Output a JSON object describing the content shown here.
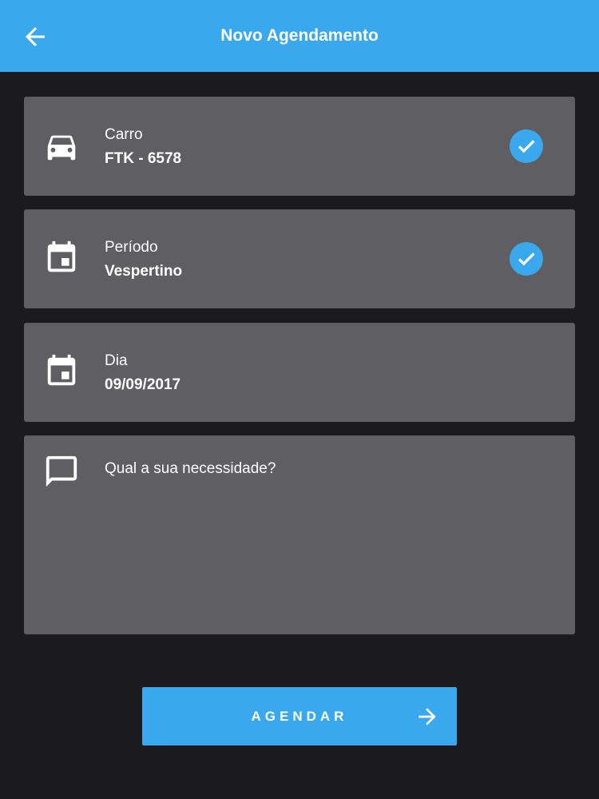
{
  "header": {
    "title": "Novo Agendamento",
    "back_icon": "arrow-left-icon",
    "background_color": "#3aa8ec"
  },
  "fields": [
    {
      "label": "Carro",
      "value": "FTK - 6578",
      "icon": "car-icon",
      "checked": true
    },
    {
      "label": "Período",
      "value": "Vespertino",
      "icon": "calendar-icon",
      "checked": true
    },
    {
      "label": "Dia",
      "value": "09/09/2017",
      "icon": "calendar-icon",
      "checked": false
    }
  ],
  "notes": {
    "placeholder": "Qual a sua necessidade?",
    "icon": "message-icon",
    "value": ""
  },
  "submit": {
    "label": "AGENDAR",
    "icon": "arrow-right-icon"
  },
  "colors": {
    "accent": "#3aa8ec",
    "background": "#1b1b1f",
    "card": "#5f5f63",
    "text": "#ffffff"
  }
}
